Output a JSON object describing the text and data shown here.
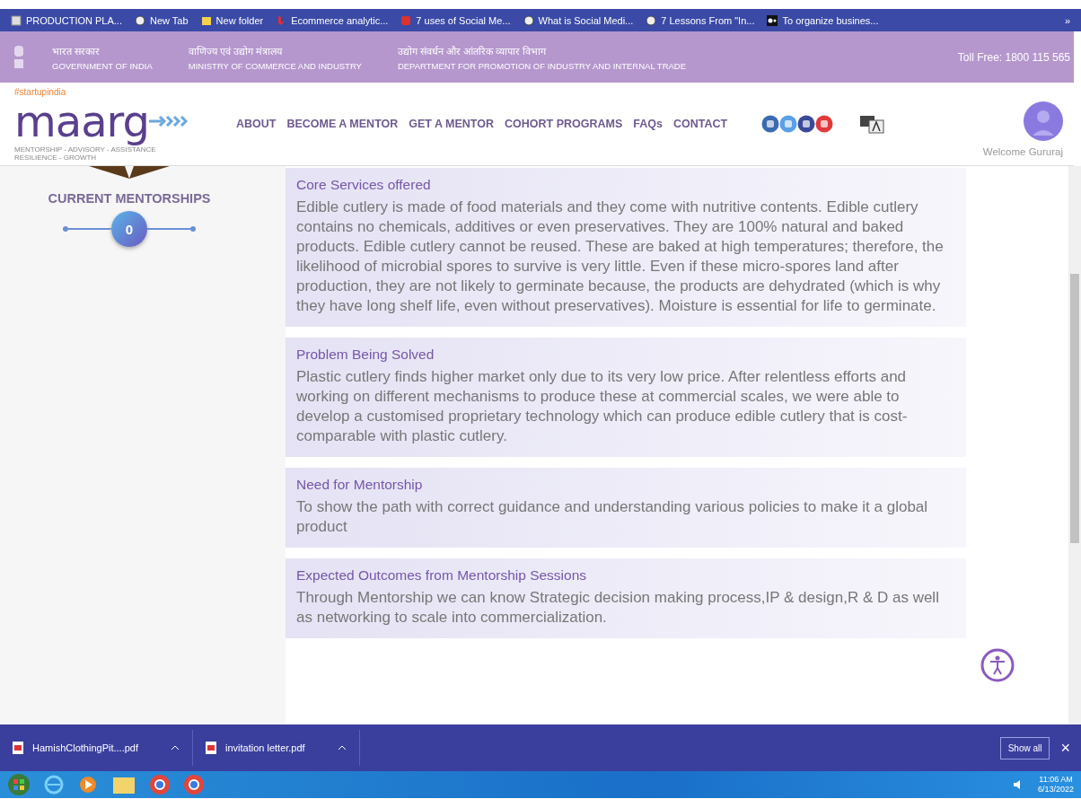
{
  "bookmarks": [
    {
      "kind": "doc",
      "label": "PRODUCTION PLA..."
    },
    {
      "kind": "globe",
      "label": "New Tab"
    },
    {
      "kind": "folder",
      "label": "New folder"
    },
    {
      "kind": "bing",
      "label": "Ecommerce analytic..."
    },
    {
      "kind": "red",
      "label": "7 uses of Social Me..."
    },
    {
      "kind": "globe",
      "label": "What is Social Medi..."
    },
    {
      "kind": "globe",
      "label": "7 Lessons From \"In..."
    },
    {
      "kind": "medium",
      "label": "To organize busines..."
    }
  ],
  "more_bookmarks": "»",
  "gov_header": {
    "departments": [
      {
        "hindi": "भारत सरकार",
        "english": "GOVERNMENT OF INDIA"
      },
      {
        "hindi": "वाणिज्य एवं उद्योग मंत्रालय",
        "english": "MINISTRY OF COMMERCE AND INDUSTRY"
      },
      {
        "hindi": "उद्योग संवर्धन और आंतरिक व्यापार विभाग",
        "english": "DEPARTMENT FOR PROMOTION OF INDUSTRY AND INTERNAL TRADE"
      }
    ],
    "toll_free": "Toll Free: 1800 115 565"
  },
  "nav": {
    "tag": "#startupindia",
    "logo": "maarg",
    "tagline": [
      "MENTORSHIP - ADVISORY - ASSISTANCE",
      "RESILIENCE - GROWTH"
    ],
    "links": [
      "ABOUT",
      "BECOME A MENTOR",
      "GET A MENTOR",
      "COHORT PROGRAMS",
      "FAQs",
      "CONTACT"
    ],
    "welcome": "Welcome Gururaj"
  },
  "sidebar": {
    "heading": "CURRENT MENTORSHIPS",
    "count": "0"
  },
  "sections": [
    {
      "title": "Core Services offered",
      "body": "Edible cutlery is made of food materials and they come with nutritive contents. Edible cutlery contains no chemicals, additives or even preservatives. They are 100% natural and baked products. Edible cutlery cannot be reused. These are baked at high temperatures; therefore, the likelihood of microbial spores to survive is very little. Even if these micro-spores land after production, they are not likely to germinate because, the products are dehydrated (which is why they have long shelf life, even without preservatives). Moisture is essential for life to germinate."
    },
    {
      "title": "Problem Being Solved",
      "body": "Plastic cutlery finds higher market only due to its very low price. After relentless efforts and working on different mechanisms to produce these at commercial scales, we were able to develop a customised proprietary technology which can produce edible cutlery that is cost-comparable with plastic cutlery."
    },
    {
      "title": "Need for Mentorship",
      "body": "To show the path with correct guidance and understanding various policies to make it a global product"
    },
    {
      "title": "Expected Outcomes from Mentorship Sessions",
      "body": "Through Mentorship we can know Strategic decision making process,IP & design,R & D as well as networking to scale into commercialization."
    }
  ],
  "downloads": {
    "files": [
      "HamishClothingPit....pdf",
      "invitation letter.pdf"
    ],
    "show_all": "Show all",
    "close": "×"
  },
  "taskbar": {
    "time": "11:06 AM",
    "date": "6/13/2022"
  }
}
